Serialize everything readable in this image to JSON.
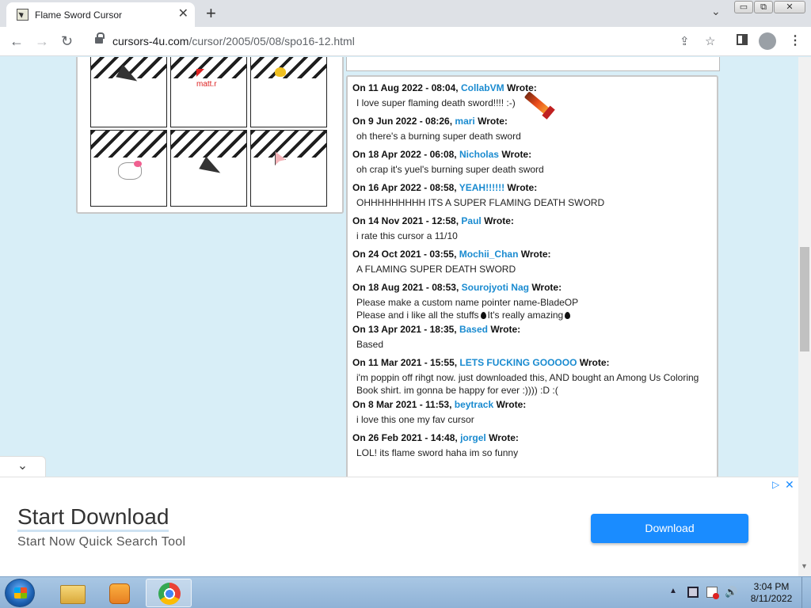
{
  "browser": {
    "tab_title": "Flame Sword Cursor",
    "tab_close": "✕",
    "new_tab": "+",
    "url_domain": "cursors-4u.com",
    "url_path": "/cursor/2005/05/08/spo16-12.html",
    "window_min": "▭",
    "window_max": "⧉",
    "window_close": "✕"
  },
  "icons": {
    "back": "←",
    "forward": "→",
    "reload": "↻",
    "share": "⇪",
    "star": "☆",
    "menu": "⋮",
    "tab_search": "⌄"
  },
  "cursor_grid": {
    "cells": [
      {
        "label": ""
      },
      {
        "label": "matt.r"
      },
      {
        "label": ""
      },
      {
        "label": ""
      },
      {
        "label": ""
      },
      {
        "label": ""
      }
    ]
  },
  "comments": [
    {
      "date": "On 11 Aug 2022 - 08:04,",
      "name": "CollabVM",
      "wrote": "Wrote:",
      "lines": [
        "I love super flaming death sword!!!! :-)"
      ]
    },
    {
      "date": "On 9 Jun 2022 - 08:26,",
      "name": "mari",
      "wrote": "Wrote:",
      "lines": [
        "oh there's a burning super death sword"
      ]
    },
    {
      "date": "On 18 Apr 2022 - 06:08,",
      "name": "Nicholas",
      "wrote": "Wrote:",
      "lines": [
        "oh crap it's yuel's burning super death sword"
      ]
    },
    {
      "date": "On 16 Apr 2022 - 08:58,",
      "name": "YEAH!!!!!!",
      "wrote": "Wrote:",
      "lines": [
        "OHHHHHHHHH ITS A SUPER FLAMING DEATH SWORD"
      ]
    },
    {
      "date": "On 14 Nov 2021 - 12:58,",
      "name": "Paul",
      "wrote": "Wrote:",
      "lines": [
        "i rate this cursor a 11/10"
      ]
    },
    {
      "date": "On 24 Oct 2021 - 03:55,",
      "name": "Mochii_Chan",
      "wrote": "Wrote:",
      "lines": [
        "A FLAMING SUPER DEATH SWORD"
      ]
    },
    {
      "date": "On 18 Aug 2021 - 08:53,",
      "name": "Sourojyoti Nag",
      "wrote": "Wrote:",
      "lines": [
        "Please make a custom name pointer name-BladeOP",
        "Please and i like all the stuffs",
        "It's really amazing"
      ]
    },
    {
      "date": "On 13 Apr 2021 - 18:35,",
      "name": "Based",
      "wrote": "Wrote:",
      "lines": [
        "Based"
      ]
    },
    {
      "date": "On 11 Mar 2021 - 15:55,",
      "name": "LETS FUCKING GOOOOO",
      "wrote": "Wrote:",
      "lines": [
        "i'm poppin off rihgt now. just downloaded this, AND bought an Among Us Coloring",
        "Book shirt. im gonna be happy for ever :)))) :D :("
      ]
    },
    {
      "date": "On 8 Mar 2021 - 11:53,",
      "name": "beytrack",
      "wrote": "Wrote:",
      "lines": [
        "i love this one my fav cursor"
      ]
    },
    {
      "date": "On 26 Feb 2021 - 14:48,",
      "name": "jorgel",
      "wrote": "Wrote:",
      "lines": [
        "LOL! its flame sword haha im so funny"
      ]
    }
  ],
  "ad": {
    "title": "Start Download",
    "subtitle": "Start Now Quick Search Tool",
    "button": "Download",
    "choices_icon": "▷",
    "close_icon": "✕",
    "collapse_icon": "⌄"
  },
  "taskbar": {
    "time": "3:04 PM",
    "date": "8/11/2022",
    "tray_arrow": "▲",
    "volume": "🔊"
  },
  "colors": {
    "page_background": "#d8eef7",
    "link_blue": "#1a8bd0",
    "ad_button": "#1a8cff"
  }
}
